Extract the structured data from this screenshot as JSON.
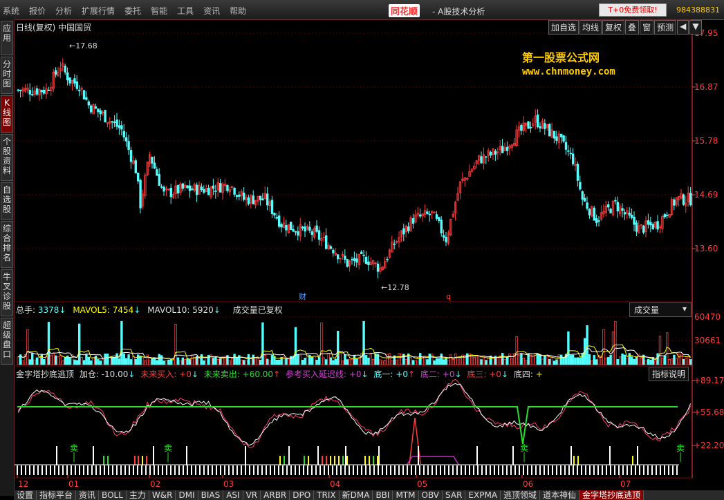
{
  "menu": [
    "系统",
    "报价",
    "分析",
    "扩展行情",
    "委托",
    "智能",
    "工具",
    "资讯",
    "帮助"
  ],
  "app": {
    "logo": "同花顺",
    "title": "- A股技术分析",
    "promo": "T+0免费领取!",
    "account": "984388831"
  },
  "leftnav": [
    "应用",
    "分时图",
    "K线图",
    "个股资料",
    "自选股",
    "综合排名",
    "牛叉诊股",
    "超级盘口"
  ],
  "kchart": {
    "title": "日线(复权)  中国国贸",
    "buttons": [
      "加自选",
      "均线",
      "复权",
      "叠",
      "窗",
      "预测"
    ],
    "price_axis": [
      "17.95",
      "16.87",
      "15.78",
      "14.69",
      "13.60"
    ],
    "max_label": "17.68",
    "min_label": "12.78",
    "marker_cai": "财",
    "marker_q": "q",
    "watermark_title": "第一股票公式网",
    "watermark_url": "www.chnmoney.com"
  },
  "volume": {
    "zongshou_label": "总手:",
    "zongshou": "3378",
    "mavol5_label": "MAVOL5:",
    "mavol5": "7454",
    "mavol10_label": "MAVOL10:",
    "mavol10": "5920",
    "note": "成交量已复权",
    "selector": "成交量",
    "axis": [
      "60470",
      "30661"
    ]
  },
  "indicator": {
    "name": "金字塔抄底逃顶",
    "jiacang_label": "加仓:",
    "jiacang": "-10.00",
    "weilai_mairu_label": "未来买入:",
    "weilai_mairu": "+0",
    "weilai_maichu_label": "未来卖出:",
    "weilai_maichu": "+60.00",
    "cankao_label": "参考买入延迟线:",
    "cankao": "+0",
    "di1_label": "底一:",
    "di1": "+0",
    "di2_label": "底二:",
    "di2": "+0",
    "di3_label": "底三:",
    "di3": "+0",
    "di4_label": "底四:",
    "di4": "+",
    "help": "指标说明",
    "axis": [
      "+89.17",
      "+55.68",
      "+22.20"
    ],
    "sell_label": "卖"
  },
  "months": [
    "12",
    "01",
    "02",
    "03",
    "04",
    "05",
    "06",
    "07"
  ],
  "tabs": [
    "设置",
    "指标平台",
    "资讯",
    "BOLL",
    "主力",
    "W&R",
    "DMI",
    "BIAS",
    "ASI",
    "VR",
    "ARBR",
    "DPO",
    "TRIX",
    "新DMA",
    "BBI",
    "MTM",
    "OBV",
    "SAR",
    "EXPMA",
    "逃顶领域",
    "道本神仙",
    "金字塔抄底逃顶"
  ],
  "colors": {
    "up": "#ff3c3c",
    "down": "#54ffff",
    "grid": "#7a0000",
    "axis": "#ff3c3c",
    "yellow": "#ffff00",
    "green": "#28e028"
  }
}
